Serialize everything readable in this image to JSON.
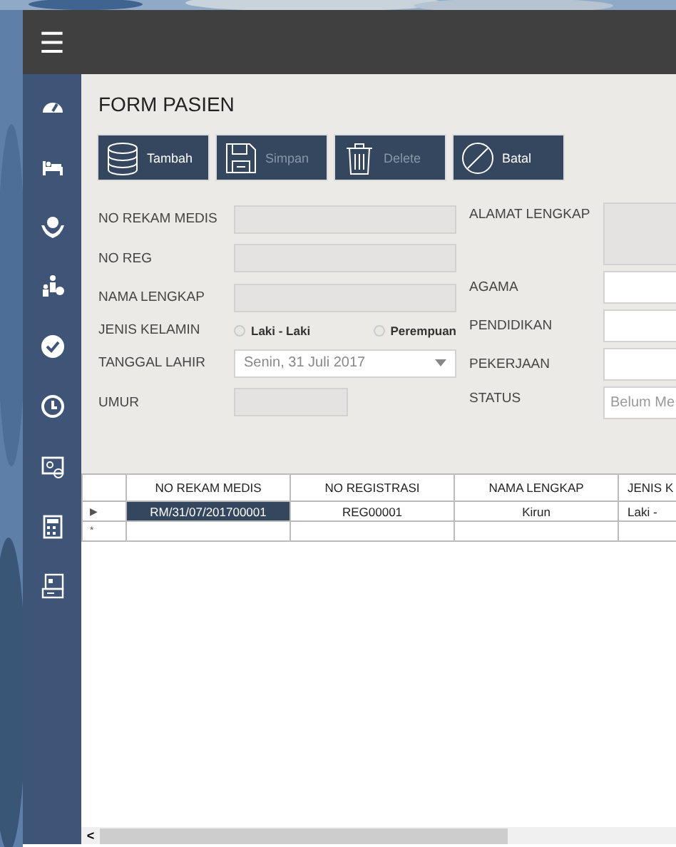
{
  "title_bar": {
    "menu_icon": "☰"
  },
  "form": {
    "title": "FORM PASIEN",
    "toolbar": [
      {
        "label": "Tambah",
        "disabled": false
      },
      {
        "label": "Simpan",
        "disabled": true
      },
      {
        "label": "Delete",
        "disabled": true
      },
      {
        "label": "Batal",
        "disabled": false
      }
    ],
    "left_fields": [
      {
        "kind": "text",
        "label": "NO REKAM MEDIS"
      },
      {
        "kind": "text",
        "label": "NO REG"
      },
      {
        "kind": "text",
        "label": "NAMA LENGKAP"
      },
      {
        "kind": "radio",
        "label": "JENIS KELAMIN",
        "options": [
          {
            "label": "Laki - Laki",
            "selected": false
          },
          {
            "label": "Perempuan",
            "selected": false
          }
        ]
      },
      {
        "kind": "date",
        "label": "TANGGAL LAHIR",
        "value": "Senin, 31 Juli 2017"
      },
      {
        "kind": "short",
        "label": "UMUR"
      }
    ],
    "right_fields": [
      {
        "kind": "area",
        "label": "ALAMAT LENGKAP"
      },
      {
        "kind": "input",
        "label": "AGAMA"
      },
      {
        "kind": "input",
        "label": "PENDIDIKAN"
      },
      {
        "kind": "input",
        "label": "PEKERJAAN"
      },
      {
        "kind": "combo",
        "label": "STATUS",
        "value": "Belum Me"
      }
    ]
  },
  "table": {
    "columns": [
      "NO REKAM MEDIS",
      "NO REGISTRASI",
      "NAMA LENGKAP",
      "JENIS K"
    ],
    "rows": [
      {
        "marker": "▶",
        "selected": true,
        "cells": [
          "RM/31/07/201700001",
          "REG00001",
          "Kirun",
          "Laki -"
        ]
      },
      {
        "marker": "*",
        "selected": false,
        "cells": [
          "",
          "",
          "",
          ""
        ]
      }
    ]
  },
  "scrollbar": {
    "arrow": "<"
  }
}
